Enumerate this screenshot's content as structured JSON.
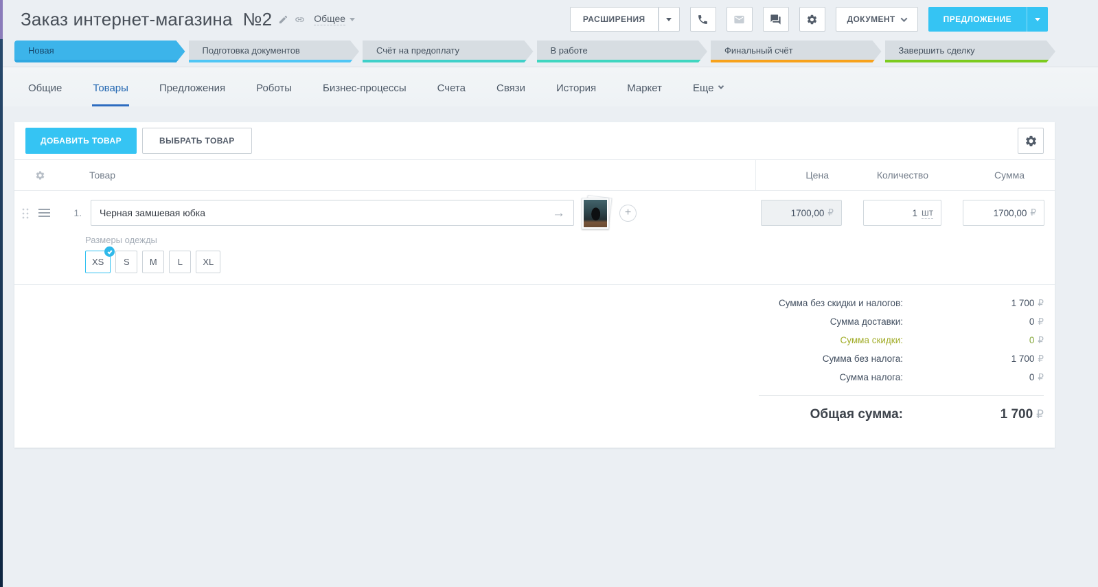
{
  "header": {
    "title": "Заказ интернет-магазина  №2",
    "category": {
      "label": "Общее"
    }
  },
  "actions": {
    "extensions": "РАСШИРЕНИЯ",
    "document": "ДОКУМЕНТ",
    "proposal": "ПРЕДЛОЖЕНИЕ",
    "icons": [
      "phone-icon",
      "mail-icon (disabled)",
      "chat-icon",
      "gear-icon"
    ]
  },
  "stages": [
    {
      "label": "Новая",
      "bg": "#3cb4ea",
      "text": "#17486c",
      "underline": "#2fa8e1",
      "active": true
    },
    {
      "label": "Подготовка документов",
      "bg": "#d7dde2",
      "text": "#45525f",
      "underline": "#4fc6f5"
    },
    {
      "label": "Счёт на предоплату",
      "bg": "#d7dde2",
      "text": "#45525f",
      "underline": "#3fd0c9"
    },
    {
      "label": "В работе",
      "bg": "#d7dde2",
      "text": "#45525f",
      "underline": "#3fd6c0"
    },
    {
      "label": "Финальный счёт",
      "bg": "#d7dde2",
      "text": "#45525f",
      "underline": "#f7a21c"
    },
    {
      "label": "Завершить сделку",
      "bg": "#d7dde2",
      "text": "#45525f",
      "underline": "#7ccb1e"
    }
  ],
  "tabs": [
    {
      "label": "Общие"
    },
    {
      "label": "Товары",
      "active": true
    },
    {
      "label": "Предложения"
    },
    {
      "label": "Роботы"
    },
    {
      "label": "Бизнес-процессы"
    },
    {
      "label": "Счета"
    },
    {
      "label": "Связи"
    },
    {
      "label": "История"
    },
    {
      "label": "Маркет"
    },
    {
      "label": "Еще",
      "caret": true
    }
  ],
  "toolbar": {
    "add_product": "ДОБАВИТЬ ТОВАР",
    "select_product": "ВЫБРАТЬ ТОВАР"
  },
  "table_headers": {
    "product": "Товар",
    "price": "Цена",
    "quantity": "Количество",
    "sum": "Сумма"
  },
  "row": {
    "index": "1.",
    "name": "Черная замшевая юбка",
    "price": "1700,00",
    "quantity": "1",
    "unit": "шт",
    "sum": "1700,00",
    "currency": "₽"
  },
  "sizes": {
    "label": "Размеры одежды",
    "options": [
      "XS",
      "S",
      "M",
      "L",
      "XL"
    ],
    "selected_index": 0
  },
  "totals": {
    "rows": [
      {
        "label": "Сумма без скидки и налогов:",
        "value": "1 700",
        "currency": "₽"
      },
      {
        "label": "Сумма доставки:",
        "value": "0",
        "currency": "₽"
      },
      {
        "label": "Сумма скидки:",
        "value": "0",
        "currency": "₽",
        "label_color": "#a2ad2a",
        "value_color": "#85a83b"
      },
      {
        "label": "Сумма без налога:",
        "value": "1 700",
        "currency": "₽"
      },
      {
        "label": "Сумма налога:",
        "value": "0",
        "currency": "₽"
      }
    ],
    "total_label": "Общая сумма:",
    "total_value": "1 700",
    "currency": "₽"
  },
  "colors": {
    "accent_cyan": "#35c4f3",
    "active_tab_blue": "#2d6cc0",
    "page_background": "#ebeff3",
    "sidebar_strip_purple": "#8a7cba",
    "sidebar_strip_navy": "#16324f",
    "currency_symbol": "#b4bcc4"
  }
}
